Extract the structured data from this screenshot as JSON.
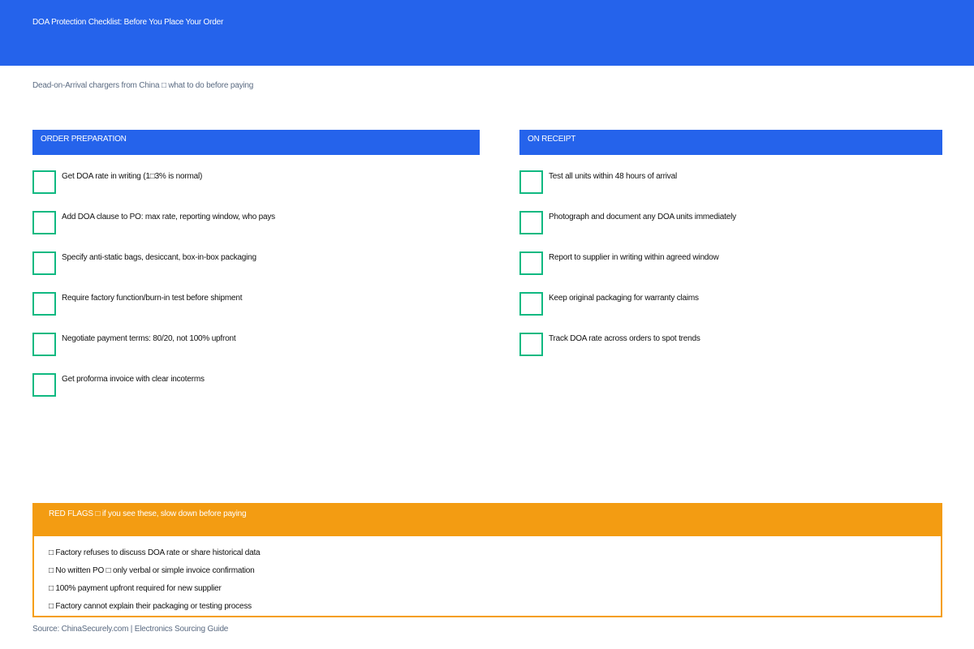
{
  "header": {
    "title": "DOA Protection Checklist: Before You Place Your Order",
    "background_color": "#2563eb"
  },
  "subtitle": "Dead-on-Arrival chargers from China □ what to do before paying",
  "sections": [
    {
      "title": "ORDER PREPARATION",
      "items": [
        {
          "label": "Get DOA rate in writing (1□3% is normal)",
          "checked": false
        },
        {
          "label": "Add DOA clause to PO: max rate, reporting window, who pays",
          "checked": false
        },
        {
          "label": "Specify anti-static bags, desiccant, box-in-box packaging",
          "checked": false
        },
        {
          "label": "Require factory function/burn-in test before shipment",
          "checked": false
        },
        {
          "label": "Negotiate payment terms: 80/20, not 100% upfront",
          "checked": false
        },
        {
          "label": "Get proforma invoice with clear incoterms",
          "checked": false
        }
      ]
    },
    {
      "title": "ON RECEIPT",
      "items": [
        {
          "label": "Test all units within 48 hours of arrival",
          "checked": false
        },
        {
          "label": "Photograph and document any DOA units immediately",
          "checked": false
        },
        {
          "label": "Report to supplier in writing within agreed window",
          "checked": false
        },
        {
          "label": "Keep original packaging for warranty claims",
          "checked": false
        },
        {
          "label": "Track DOA rate across orders to spot trends",
          "checked": false
        }
      ]
    }
  ],
  "red_flags": {
    "title": "RED FLAGS □ if you see these, slow down before paying",
    "items": [
      "□ Factory refuses to discuss DOA rate or share historical data",
      "□ No written PO □ only verbal or simple invoice confirmation",
      "□ 100% payment upfront required for new supplier",
      "□ Factory cannot explain their packaging or testing process"
    ]
  },
  "source": "Source: ChinaSecurely.com | Electronics Sourcing Guide",
  "colors": {
    "accent_blue": "#2563eb",
    "checkbox_green": "#10b981",
    "warning_orange": "#f39c12",
    "muted_text": "#5b6b82"
  }
}
